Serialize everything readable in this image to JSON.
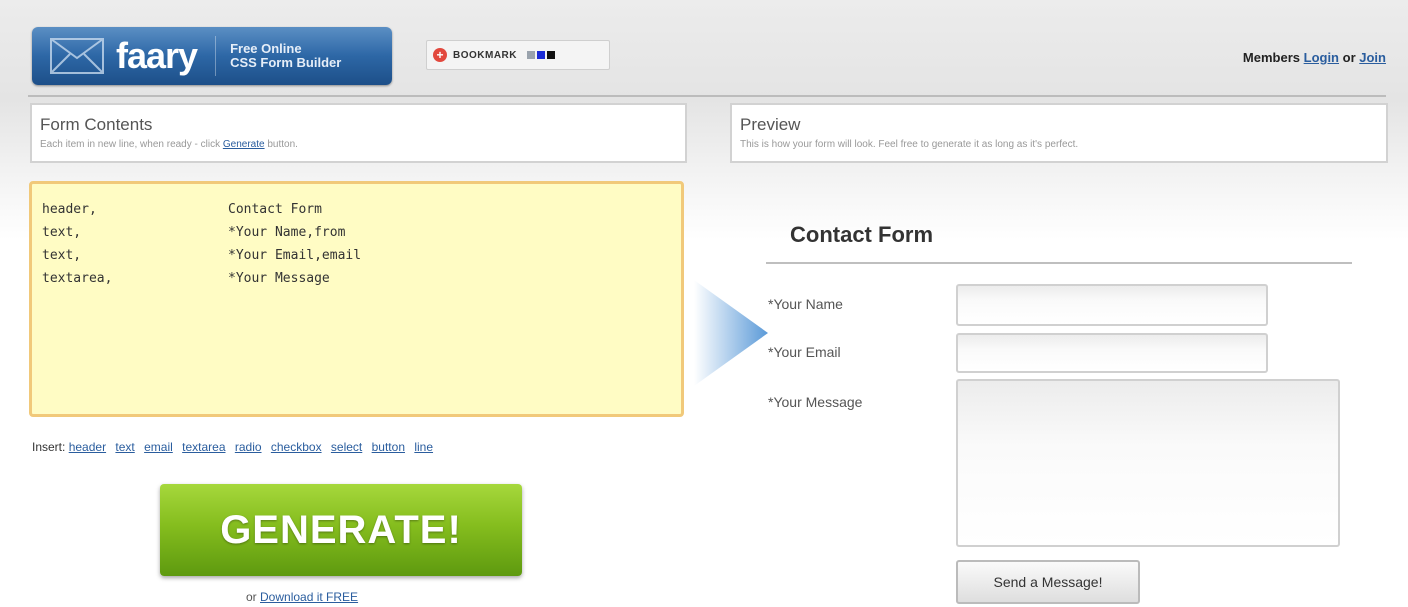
{
  "header": {
    "logo_name": "faary",
    "logo_tagline_1": "Free Online",
    "logo_tagline_2": "CSS Form Builder",
    "bookmark_label": "BOOKMARK",
    "members_label": "Members",
    "login_link": "Login",
    "or_text": "or",
    "join_link": "Join"
  },
  "form_contents": {
    "title": "Form Contents",
    "subtitle_prefix": "Each item in new line, when ready - click",
    "subtitle_link": "Generate",
    "subtitle_suffix": "button."
  },
  "preview": {
    "title": "Preview",
    "subtitle": "This is how your form will look. Feel free to generate it as long as it's perfect."
  },
  "editor": {
    "lines": [
      {
        "type": "header,",
        "value": "Contact Form"
      },
      {
        "type": "text,",
        "value": "*Your Name,from"
      },
      {
        "type": "text,",
        "value": "*Your Email,email"
      },
      {
        "type": "textarea,",
        "value": "*Your Message"
      }
    ]
  },
  "insert": {
    "label": "Insert:",
    "links": [
      "header",
      "text",
      "email",
      "textarea",
      "radio",
      "checkbox",
      "select",
      "button",
      "line"
    ]
  },
  "generate_label": "GENERATE!",
  "download": {
    "prefix": "or",
    "link": "Download it FREE"
  },
  "form_preview": {
    "title": "Contact Form",
    "name_label": "*Your Name",
    "email_label": "*Your Email",
    "message_label": "*Your Message",
    "send_label": "Send a Message!"
  },
  "colors": {
    "logo_blue": "#2d67a6",
    "editor_bg": "#fffcc4",
    "editor_border": "#f1c97a",
    "generate_green": "#85bd1e",
    "link_blue": "#2a5d9e"
  }
}
